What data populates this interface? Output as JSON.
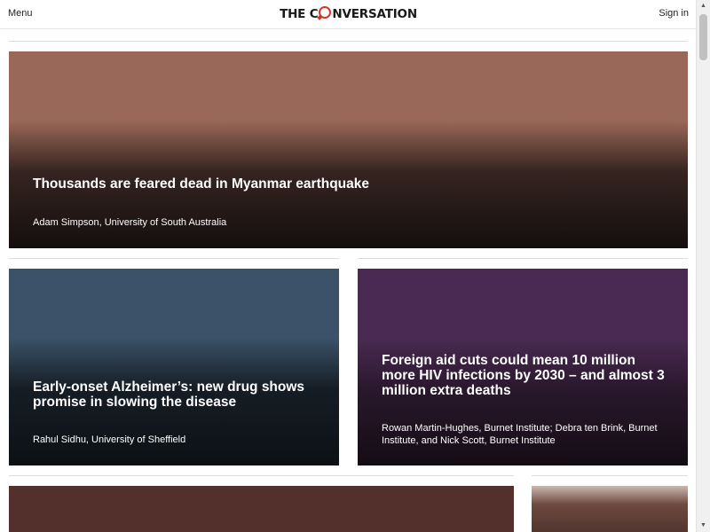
{
  "header": {
    "menu_label": "Menu",
    "logo_part1": "THE C",
    "logo_o": "O",
    "logo_part2": "NVERSATION",
    "signin_label": "Sign in"
  },
  "articles": [
    {
      "title": "Thousands are feared dead in Myanmar earthquake",
      "byline": "Adam Simpson, University of South Australia"
    },
    {
      "title": "Early-onset Alzheimer’s: new drug shows promise in slowing the disease",
      "byline": "Rahul Sidhu, University of Sheffield"
    },
    {
      "title": "Foreign aid cuts could mean 10 million more HIV infections by 2030 – and almost 3 million extra deaths",
      "byline": "Rowan Martin-Hughes, Burnet Institute; Debra ten Brink, Burnet Institute, and Nick Scott, Burnet Institute"
    }
  ],
  "scrollbar": {
    "up_icon": "▲",
    "down_icon": "▼"
  },
  "colors": {
    "brand_red": "#d8352a",
    "hero_bg": "#9a6858",
    "alzheimers_bg": "#3b5268",
    "aid_bg": "#4a2a52",
    "bottom_left_bg": "#54302d"
  }
}
